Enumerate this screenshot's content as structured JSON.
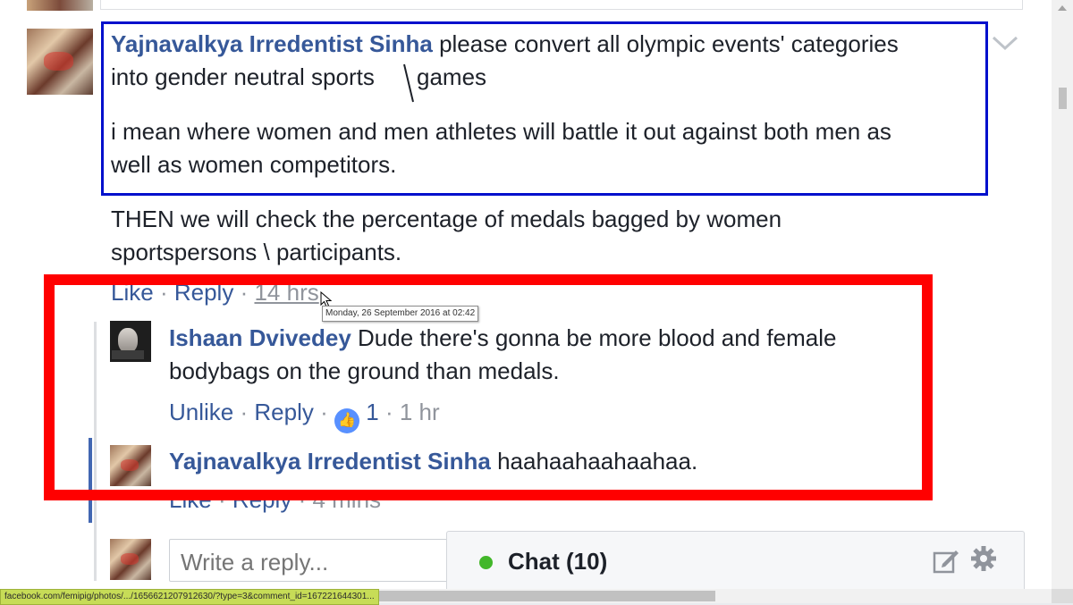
{
  "comment": {
    "author": "Yajnavalkya Irredentist Sinha",
    "text_1a": " please convert all olympic events' categories",
    "text_1b": "into gender neutral sports",
    "text_1c": "games",
    "text_2a": "i mean where women and men athletes will battle it out against both men as",
    "text_2b": "well as women competitors.",
    "text_3a": "THEN we will check the percentage of medals bagged by women",
    "text_3b": "sportspersons \\ participants.",
    "like_label": "Like",
    "reply_label": "Reply",
    "timestamp": "14 hrs",
    "tooltip": "Monday, 26 September 2016 at 02:42"
  },
  "reply_1": {
    "author": "Ishaan Dvivedey",
    "text_a": " Dude there's gonna be more blood and female",
    "text_b": "bodybags on the ground than medals.",
    "unlike_label": "Unlike",
    "reply_label": "Reply",
    "like_count": "1",
    "timestamp": "1 hr"
  },
  "reply_2": {
    "author": "Yajnavalkya Irredentist Sinha",
    "text": " haahaahaahaahaa.",
    "like_label": "Like",
    "reply_label": "Reply",
    "timestamp": "4 mins"
  },
  "reply_box": {
    "placeholder": "Write a reply..."
  },
  "chat": {
    "label": "Chat (10)",
    "status_color": "#42b72a"
  },
  "status_bar": {
    "url": "facebook.com/femipig/photos/.../1656621207912630/?type=3&comment_id=167221644301..."
  },
  "separator": "·",
  "colors": {
    "link": "#365899",
    "annotation_blue": "#0010cc",
    "annotation_red": "#ff0000"
  }
}
